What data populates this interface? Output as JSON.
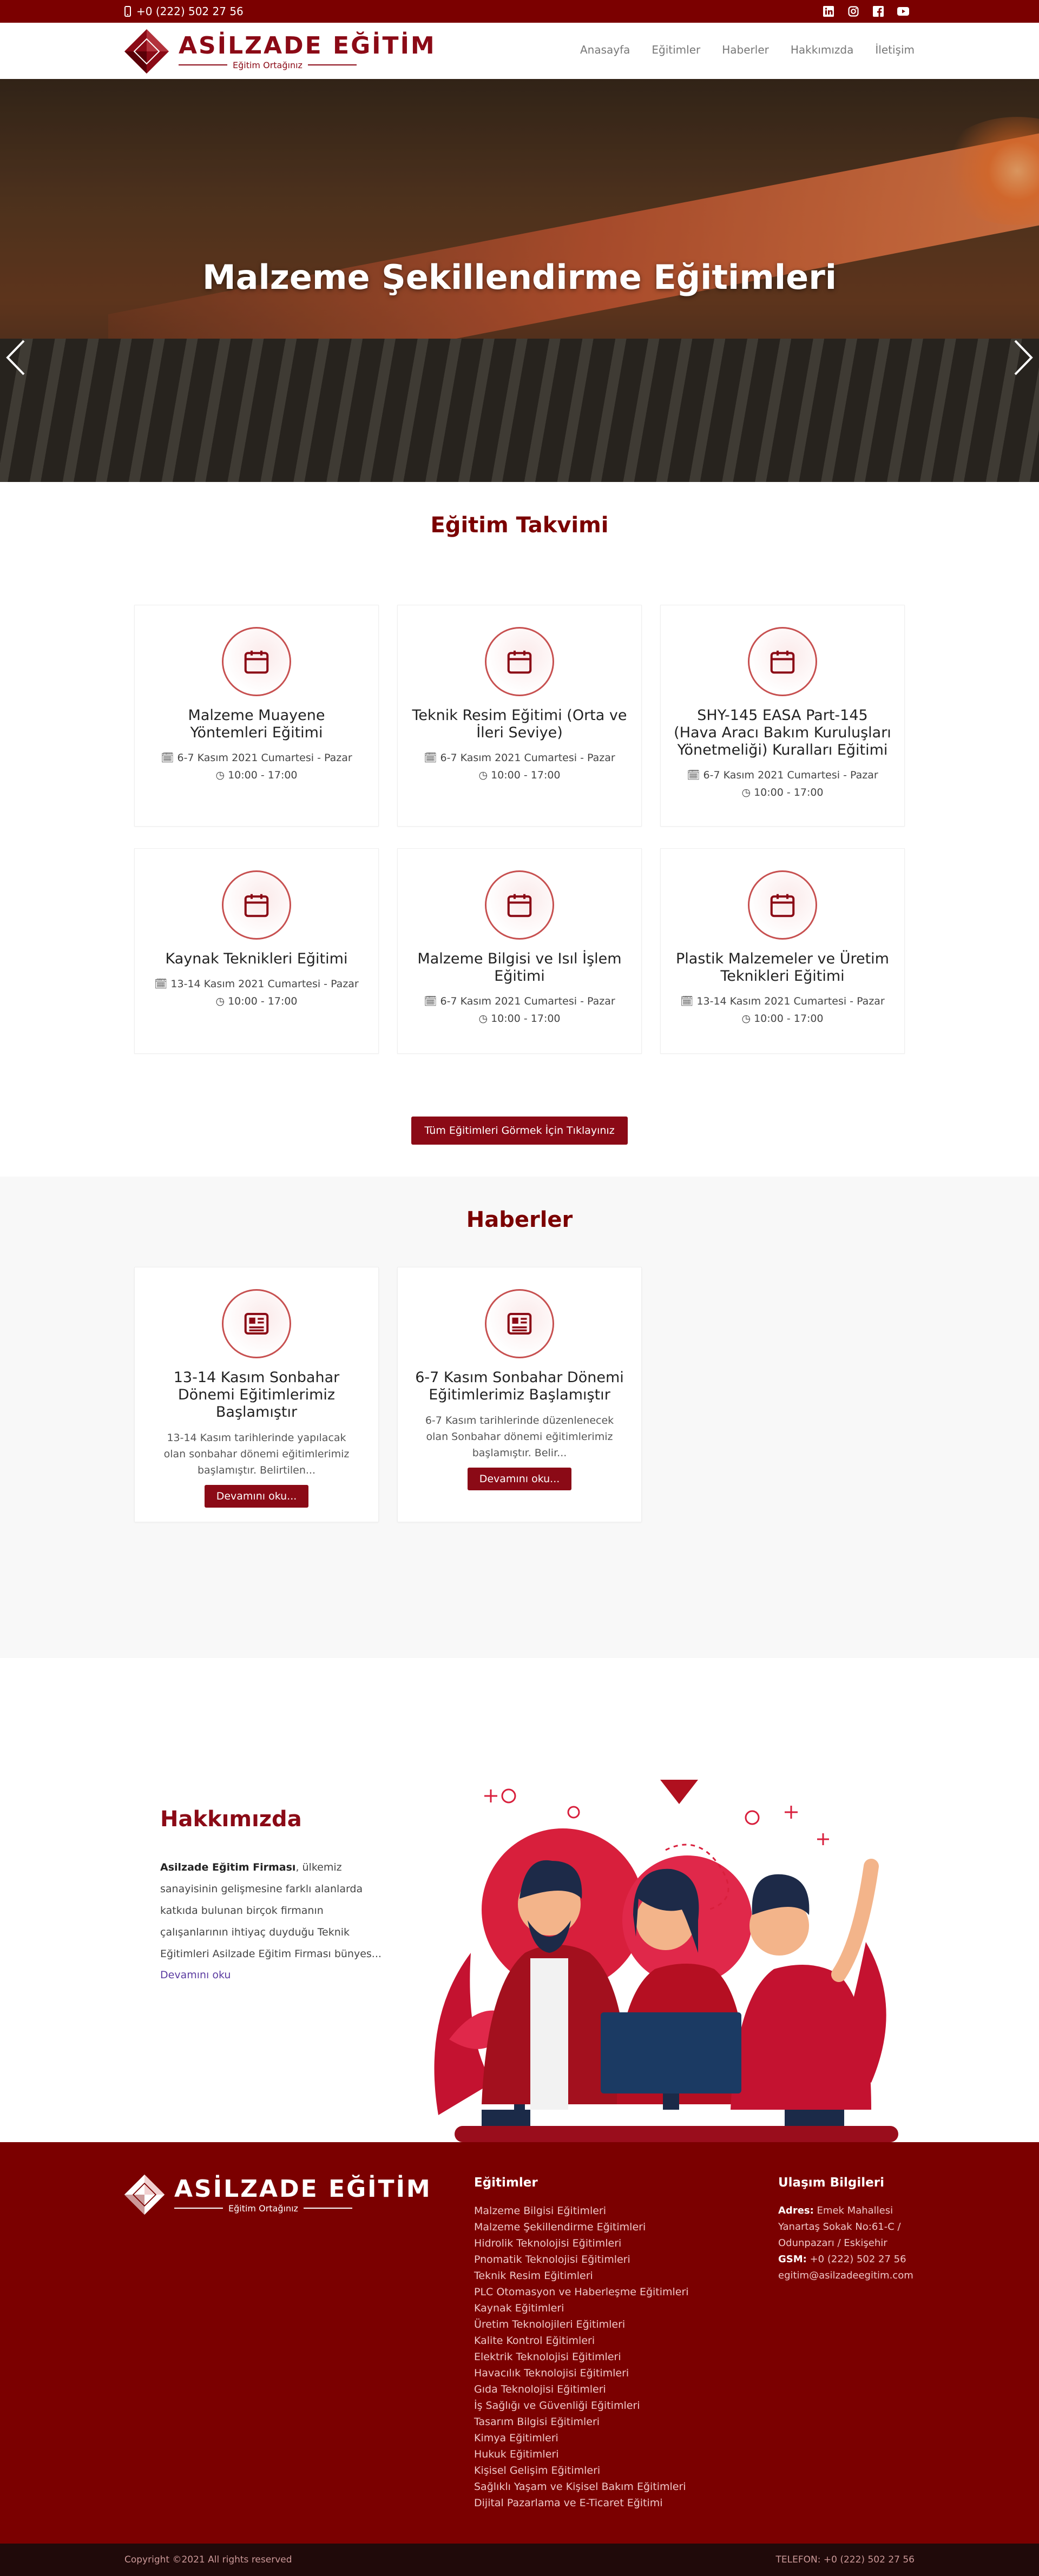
{
  "topbar": {
    "phone": "+0 (222) 502 27 56",
    "socials": [
      "linkedin-icon",
      "instagram-icon",
      "facebook-icon",
      "youtube-icon"
    ]
  },
  "brand": {
    "name": "ASİLZADE EĞİTİM",
    "tagline": "Eğitim Ortağınız"
  },
  "nav": [
    "Anasayfa",
    "Eğitimler",
    "Haberler",
    "Hakkımızda",
    "İletişim"
  ],
  "hero": {
    "title": "Malzeme Şekillendirme Eğitimleri",
    "slide_count": 9,
    "active_slide": 1
  },
  "calendar": {
    "title": "Eğitim Takvimi",
    "items": [
      {
        "title": "Malzeme Muayene Yöntemleri Eğitimi",
        "date": "6-7 Kasım 2021 Cumartesi - Pazar",
        "time": "10:00 - 17:00"
      },
      {
        "title": "Teknik Resim Eğitimi (Orta ve İleri Seviye)",
        "date": "6-7 Kasım 2021 Cumartesi - Pazar",
        "time": "10:00 - 17:00"
      },
      {
        "title": "SHY-145 EASA Part-145 (Hava Aracı Bakım Kuruluşları Yönetmeliği) Kuralları Eğitimi",
        "date": "6-7 Kasım 2021 Cumartesi - Pazar",
        "time": "10:00 - 17:00"
      },
      {
        "title": "Kaynak Teknikleri Eğitimi",
        "date": "13-14 Kasım 2021 Cumartesi - Pazar",
        "time": "10:00 - 17:00"
      },
      {
        "title": "Malzeme Bilgisi ve Isıl İşlem Eğitimi",
        "date": "6-7 Kasım 2021 Cumartesi - Pazar",
        "time": "10:00 - 17:00"
      },
      {
        "title": "Plastik Malzemeler ve Üretim Teknikleri Eğitimi",
        "date": "13-14 Kasım 2021 Cumartesi - Pazar",
        "time": "10:00 - 17:00"
      }
    ],
    "all_button": "Tüm Eğitimleri Görmek İçin Tıklayınız"
  },
  "news": {
    "title": "Haberler",
    "items": [
      {
        "title": "13-14 Kasım Sonbahar Dönemi Eğitimlerimiz Başlamıştır",
        "excerpt": "13-14 Kasım tarihlerinde yapılacak olan sonbahar dönemi eğitimlerimiz başlamıştır. Belirtilen...",
        "more": "Devamını oku..."
      },
      {
        "title": "6-7 Kasım Sonbahar Dönemi Eğitimlerimiz Başlamıştır",
        "excerpt": "6-7 Kasım tarihlerinde düzenlenecek olan Sonbahar dönemi eğitimlerimiz başlamıştır. Belir...",
        "more": "Devamını oku..."
      }
    ]
  },
  "about": {
    "title": "Hakkımızda",
    "company": "Asilzade Eğitim Firması",
    "text": ", ülkemiz sanayisinin gelişmesine farklı alanlarda katkıda bulunan birçok firmanın çalışanlarının ihtiyaç duyduğu Teknik Eğitimleri Asilzade Eğitim Firması bünyes...",
    "more": "Devamını oku"
  },
  "footer": {
    "trainings_title": "Eğitimler",
    "trainings": [
      "Malzeme Bilgisi Eğitimleri",
      "Malzeme Şekillendirme Eğitimleri",
      "Hidrolik Teknolojisi Eğitimleri",
      "Pnomatik Teknolojisi Eğitimleri",
      "Teknik Resim Eğitimleri",
      "PLC Otomasyon ve Haberleşme Eğitimleri",
      "Kaynak Eğitimleri",
      "Üretim Teknolojileri Eğitimleri",
      "Kalite Kontrol Eğitimleri",
      "Elektrik Teknolojisi Eğitimleri",
      "Havacılık Teknolojisi Eğitimleri",
      "Gıda Teknolojisi Eğitimleri",
      "İş Sağlığı ve Güvenliği Eğitimleri",
      "Tasarım Bilgisi Eğitimleri",
      "Kimya Eğitimleri",
      "Hukuk Eğitimleri",
      "Kişisel Gelişim Eğitimleri",
      "Sağlıklı Yaşam ve Kişisel Bakım Eğitimleri",
      "Dijital Pazarlama ve E-Ticaret Eğitimi"
    ],
    "contact_title": "Ulaşım Bilgileri",
    "address_label": "Adres:",
    "address": "Emek Mahallesi Yanartaş Sokak No:61-C / Odunpazarı / Eskişehir",
    "gsm_label": "GSM:",
    "gsm": "+0 (222) 502 27 56",
    "email": "egitim@asilzadeegitim.com"
  },
  "bottom": {
    "copyright": "Copyright ©2021 All rights reserved",
    "phone": "TELEFON: +0 (222) 502 27 56"
  },
  "colors": {
    "brand": "#7b0000",
    "accent": "#8b0a16",
    "link": "#5a3aa0"
  }
}
